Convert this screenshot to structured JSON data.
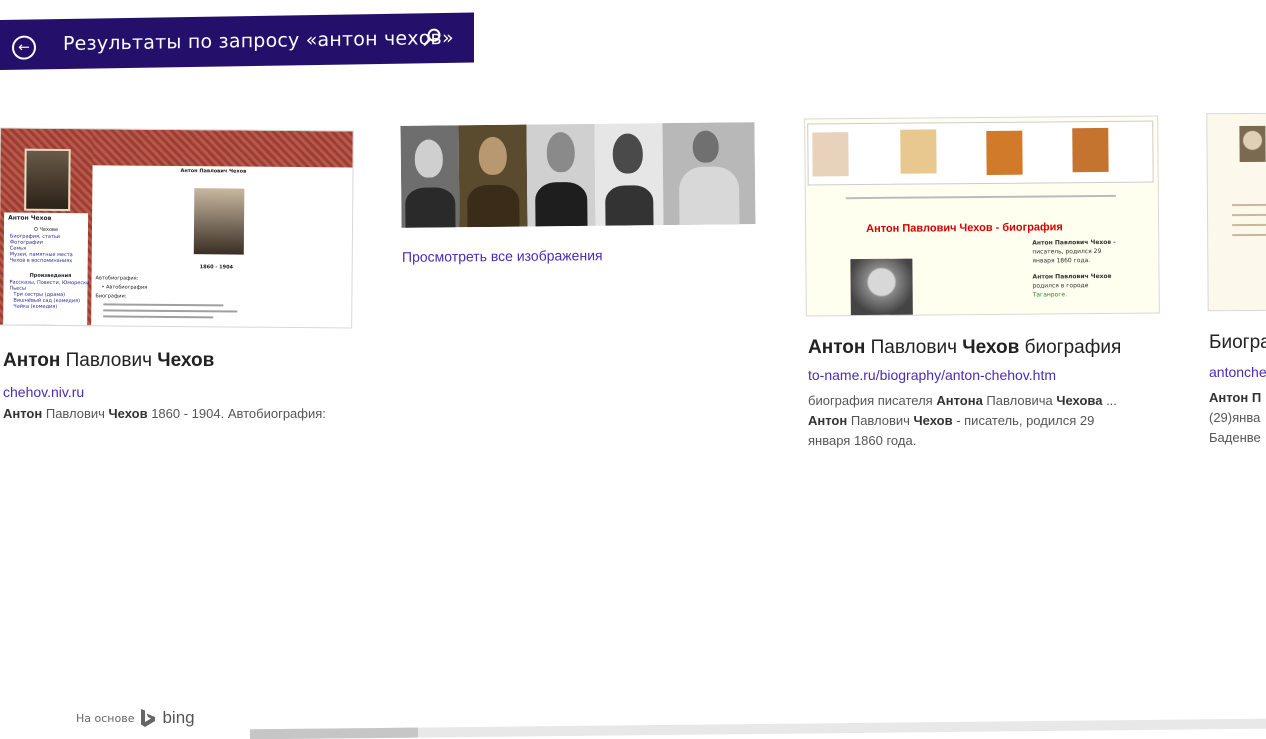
{
  "header": {
    "back_label": "←",
    "title": "Результаты по запросу «антон чехов»"
  },
  "results": [
    {
      "title_parts": [
        "Антон",
        " Павлович ",
        "Чехов"
      ],
      "url": "chehov.niv.ru",
      "snippet_parts": [
        "Антон",
        " Павлович ",
        "Чехов",
        " 1860 - 1904. Автобиография:"
      ],
      "thumb": {
        "name": "Антон Чехов",
        "heading": "Антон Павлович Чехов",
        "years": "1860 - 1904",
        "menu_title": "О Чехове",
        "menu": [
          "Биография, статьи",
          "Фотографии",
          "Семья",
          "Музеи, памятные места",
          "Чехов в воспоминаниях"
        ],
        "works_title": "Произведения",
        "works": [
          "Рассказы, Повести, Юморески",
          "Пьесы",
          "Три сестры (драма)",
          "Вишнёвый сад (комедия)",
          "Чайка (комедия)"
        ],
        "main_lines": [
          "Автобиография:",
          "• Автобиография",
          "Биографии:"
        ]
      }
    },
    {
      "see_all": "Просмотреть все изображения"
    },
    {
      "title_parts": [
        "Антон",
        " Павлович ",
        "Чехов",
        " биография"
      ],
      "url": "to-name.ru/biography/anton-chehov.htm",
      "snippet_line1_parts": [
        "биография писателя ",
        "Антона",
        " Павловича ",
        "Чехова",
        " ..."
      ],
      "snippet_line2_parts": [
        "Антон",
        " Павлович ",
        "Чехов",
        " - писатель, родился 29"
      ],
      "snippet_line3": "января 1860 года.",
      "thumb": {
        "heading": "Антон Павлович Чехов - биография",
        "bio": [
          "Антон Павлович Чехов -",
          "писатель, родился 29",
          "января 1860 года.",
          "Антон Павлович Чехов",
          "родился в городе",
          "Таганроге."
        ]
      }
    },
    {
      "title": "Биогра",
      "url": "antonche",
      "snippet_lines": [
        "Антон П",
        "(29)янва",
        "Баденве"
      ]
    }
  ],
  "footer": {
    "powered_by": "На основе",
    "brand": "bing"
  },
  "colors": {
    "header_bg": "#24106b",
    "link": "#4b2bb5",
    "ad_title_red": "#d40000"
  }
}
